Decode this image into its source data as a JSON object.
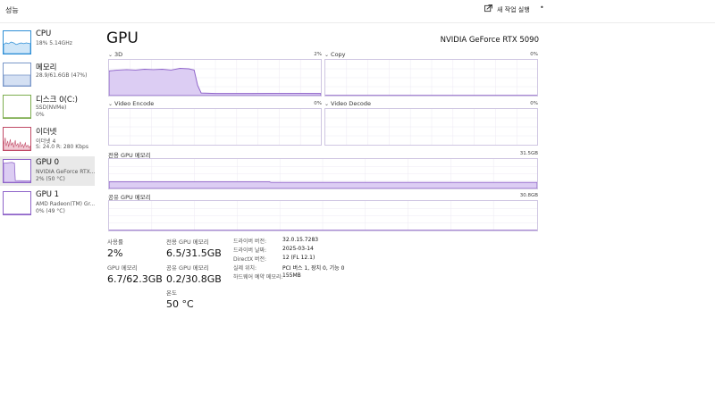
{
  "header": {
    "title": "성능",
    "run_task_label": "새 작업 실행",
    "more_label": "•"
  },
  "sidebar": {
    "items": [
      {
        "name": "CPU",
        "sub1": "18%  5.14GHz",
        "sub2": ""
      },
      {
        "name": "메모리",
        "sub1": "28.9/61.6GB (47%)",
        "sub2": ""
      },
      {
        "name": "디스크 0(C:)",
        "sub1": "SSD(NVMe)",
        "sub2": "0%"
      },
      {
        "name": "이더넷",
        "sub1": "이더넷 4",
        "sub2": "S: 24.0  R: 280 Kbps"
      },
      {
        "name": "GPU 0",
        "sub1": "NVIDIA GeForce RTX...",
        "sub2": "2% (50 °C)"
      },
      {
        "name": "GPU 1",
        "sub1": "AMD Radeon(TM) Gr...",
        "sub2": "0% (49 °C)"
      }
    ]
  },
  "main": {
    "title": "GPU",
    "model": "NVIDIA GeForce RTX 5090",
    "graphs": {
      "g3d": {
        "label": "3D",
        "pct": "2%"
      },
      "copy": {
        "label": "Copy",
        "pct": "0%"
      },
      "venc": {
        "label": "Video Encode",
        "pct": "0%"
      },
      "vdec": {
        "label": "Video Decode",
        "pct": "0%"
      },
      "dedicated": {
        "label": "전용 GPU 메모리",
        "max": "31.5GB"
      },
      "shared": {
        "label": "공유 GPU 메모리",
        "max": "30.8GB"
      }
    }
  },
  "stats": {
    "usage_label": "사용률",
    "usage_value": "2%",
    "gpu_mem_label": "GPU 메모리",
    "gpu_mem_value": "6.7/62.3GB",
    "dedicated_label": "전용 GPU 메모리",
    "dedicated_value": "6.5/31.5GB",
    "shared_label": "공유 GPU 메모리",
    "shared_value": "0.2/30.8GB",
    "temp_label": "온도",
    "temp_value": "50 °C",
    "info": [
      {
        "key": "드라이버 버전:",
        "val": "32.0.15.7283"
      },
      {
        "key": "드라이버 날짜:",
        "val": "2025-03-14"
      },
      {
        "key": "DirectX 버전:",
        "val": "12 (FL 12.1)"
      },
      {
        "key": "실제 위치:",
        "val": "PCI 버스 1, 장치 0, 기능 0"
      },
      {
        "key": "하드웨어 예약 메모리:",
        "val": "155MB"
      }
    ]
  },
  "colors": {
    "gpu_line": "#8e63c9",
    "gpu_fill": "#dccdf3",
    "cpu_line": "#2e8fd6",
    "cpu_fill": "#cfe6f8",
    "mem_line": "#7a97c9",
    "mem_fill": "#d4e0f3",
    "disk_line": "#7cad4e",
    "eth_line": "#c04a66",
    "eth_fill": "#f1c9d3",
    "grid": "#ece8f3"
  }
}
